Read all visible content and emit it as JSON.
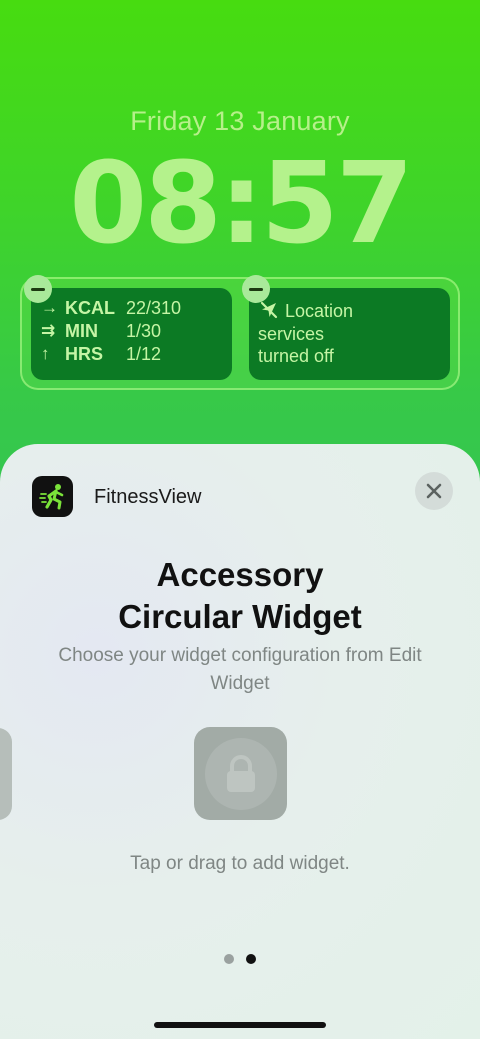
{
  "lock_screen": {
    "date": "Friday 13 January",
    "time": "08:57",
    "fitness_widget": {
      "rows": [
        {
          "arrow": "→",
          "key": "KCAL",
          "value": "22/310"
        },
        {
          "arrow": "⇉",
          "key": "MIN",
          "value": "1/30"
        },
        {
          "arrow": "↑",
          "key": "HRS",
          "value": "1/12"
        }
      ]
    },
    "location_widget": {
      "lines": [
        "Location",
        "services",
        "turned off"
      ]
    }
  },
  "sheet": {
    "app_name": "FitnessView",
    "title_line1": "Accessory",
    "title_line2": "Circular Widget",
    "subtitle": "Choose your widget configuration from Edit Widget",
    "hint": "Tap or drag to add widget.",
    "page_index": 2,
    "page_count": 2
  },
  "colors": {
    "wallpaper_top": "#47dc10",
    "widget_bg": "#0c7a24",
    "widget_text": "#c5f5a5",
    "clock_text": "#b4f28c"
  }
}
